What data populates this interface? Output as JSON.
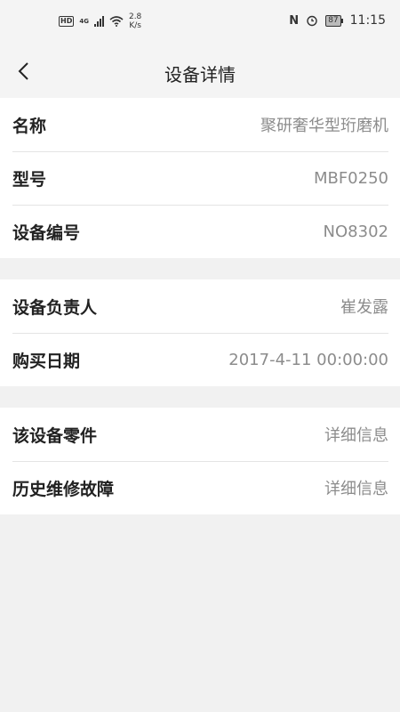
{
  "status_bar": {
    "hd": "HD",
    "network": "4G",
    "speed_value": "2.8",
    "speed_unit": "K/s",
    "nfc": "N",
    "battery": "87",
    "time": "11:15"
  },
  "header": {
    "title": "设备详情",
    "back_icon": "chevron-left-icon"
  },
  "groups": [
    {
      "rows": [
        {
          "label": "名称",
          "value": "聚研奢华型珩磨机"
        },
        {
          "label": "型号",
          "value": "MBF0250"
        },
        {
          "label": "设备编号",
          "value": "NO8302"
        }
      ]
    },
    {
      "rows": [
        {
          "label": "设备负责人",
          "value": "崔发露"
        },
        {
          "label": "购买日期",
          "value": "2017-4-11 00:00:00"
        }
      ]
    },
    {
      "rows": [
        {
          "label": "该设备零件",
          "value": "详细信息"
        },
        {
          "label": "历史维修故障",
          "value": "详细信息"
        }
      ]
    }
  ]
}
